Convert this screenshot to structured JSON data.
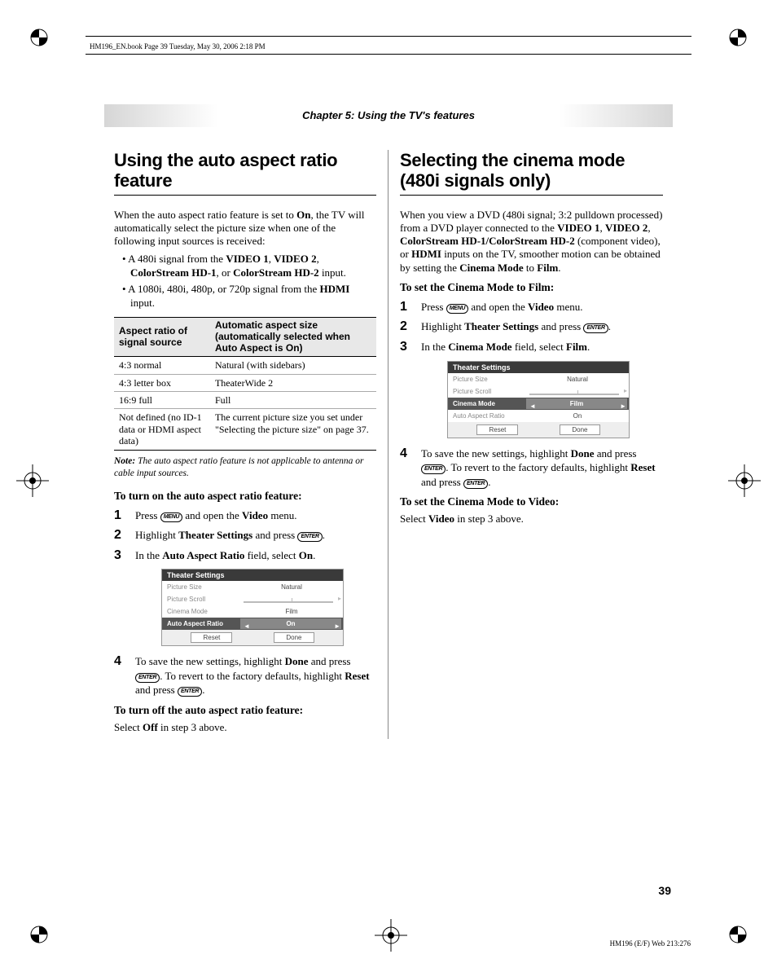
{
  "bookHeader": "HM196_EN.book  Page 39  Tuesday, May 30, 2006  2:18 PM",
  "chapterBanner": "Chapter 5: Using the TV's features",
  "left": {
    "heading": "Using the auto aspect ratio feature",
    "intro1a": "When the auto aspect ratio feature is set to ",
    "intro1b": "On",
    "intro1c": ", the TV will automatically select the picture size when one of the following input sources is received:",
    "bul1a": "A 480i signal from the ",
    "bul1b": "VIDEO 1",
    "bul1c": "VIDEO 2",
    "bul1d": "ColorStream HD-1",
    "bul1e": "ColorStream HD-2",
    "bul1f": " input.",
    "bul2a": "A 1080i, 480i, 480p, or 720p signal from the ",
    "bul2b": "HDMI",
    "bul2c": " input.",
    "table": {
      "h1": "Aspect ratio of signal source",
      "h2": "Automatic aspect size (automatically selected when Auto Aspect is On)",
      "r1c1": "4:3 normal",
      "r1c2": "Natural (with sidebars)",
      "r2c1": "4:3 letter box",
      "r2c2": "TheaterWide 2",
      "r3c1": "16:9 full",
      "r3c2": "Full",
      "r4c1": "Not defined (no ID-1 data or HDMI aspect data)",
      "r4c2": "The current picture size you set under \"Selecting the picture size\" on page 37."
    },
    "noteLabel": "Note:",
    "noteText": " The auto aspect ratio feature is not applicable to antenna or cable input sources.",
    "sub1": "To turn on the auto aspect ratio feature:",
    "s1a": "Press ",
    "s1b": " and open the ",
    "s1c": "Video",
    "s1d": " menu.",
    "s2a": "Highlight ",
    "s2b": "Theater Settings",
    "s2c": " and press ",
    "s3a": "In the ",
    "s3b": "Auto Aspect Ratio",
    "s3c": " field, select ",
    "s3d": "On",
    "s4a": "To save the new settings, highlight ",
    "s4b": "Done",
    "s4c": " and press ",
    "s4d": ". To revert to the factory defaults, highlight ",
    "s4e": "Reset",
    "s4f": " and press ",
    "sub2": "To turn off the auto aspect ratio feature:",
    "off1a": "Select ",
    "off1b": "Off",
    "off1c": " in step 3 above.",
    "osd": {
      "title": "Theater Settings",
      "r1l": "Picture Size",
      "r1v": "Natural",
      "r2l": "Picture Scroll",
      "r3l": "Cinema Mode",
      "r3v": "Film",
      "r4l": "Auto Aspect Ratio",
      "r4v": "On",
      "btn1": "Reset",
      "btn2": "Done"
    }
  },
  "right": {
    "heading": "Selecting the cinema mode (480i signals only)",
    "intro1a": "When you view a DVD (480i signal; 3:2 pulldown processed) from a DVD player connected to the ",
    "i1": "VIDEO 1",
    "i2": "VIDEO 2",
    "i3": "ColorStream HD-1/ColorStream HD-2",
    "intro1b": " (component video), or ",
    "i4": "HDMI",
    "intro1c": " inputs on the TV, smoother motion can be obtained by setting the ",
    "i5": "Cinema Mode",
    "intro1d": " to ",
    "i6": "Film",
    "sub1": "To set the Cinema Mode to Film:",
    "s1a": "Press ",
    "s1b": " and open the ",
    "s1c": "Video",
    "s1d": " menu.",
    "s2a": "Highlight ",
    "s2b": "Theater Settings",
    "s2c": " and press ",
    "s3a": "In the ",
    "s3b": "Cinema Mode",
    "s3c": " field, select ",
    "s3d": "Film",
    "s4a": "To save the new settings, highlight ",
    "s4b": "Done",
    "s4c": " and press ",
    "s4d": ". To revert to the factory defaults, highlight ",
    "s4e": "Reset",
    "s4f": " and press ",
    "sub2": "To set the Cinema Mode to Video:",
    "off1a": "Select ",
    "off1b": "Video",
    "off1c": " in step 3 above.",
    "osd": {
      "title": "Theater Settings",
      "r1l": "Picture Size",
      "r1v": "Natural",
      "r2l": "Picture Scroll",
      "r3l": "Cinema Mode",
      "r3v": "Film",
      "r4l": "Auto Aspect Ratio",
      "r4v": "On",
      "btn1": "Reset",
      "btn2": "Done"
    }
  },
  "pageNum": "39",
  "footerId": "HM196 (E/F) Web 213:276",
  "iconMenu": "MENU",
  "iconEnter": "ENTER",
  "nums": {
    "1": "1",
    "2": "2",
    "3": "3",
    "4": "4"
  }
}
